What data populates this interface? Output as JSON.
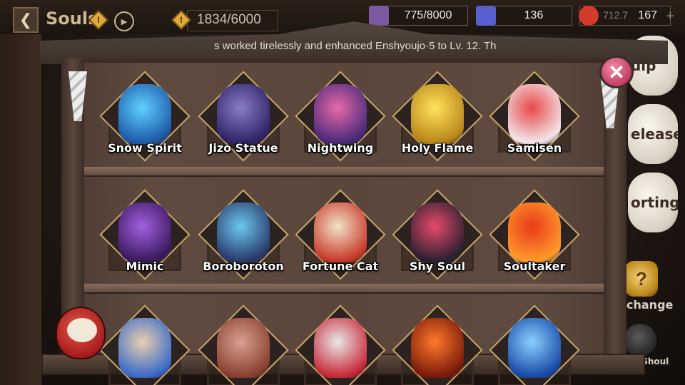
{
  "header": {
    "title": "Souls",
    "alert_glyph": "!",
    "capacity": "1834/6000"
  },
  "resources": [
    {
      "name": "stamina",
      "value": "775/8000",
      "color": "#7a5aa0"
    },
    {
      "name": "jade",
      "value": "136",
      "color": "#5a5fd0"
    },
    {
      "name": "event-currency",
      "value": "167",
      "color": "#d23a2a"
    }
  ],
  "overlay_value": "712.7",
  "ticker": "s worked tirelessly and enhanced Enshyoujo·5 to Lv. 12. Th",
  "side_buttons": {
    "quip": "uip",
    "release": "elease",
    "sorting": "orting",
    "change": "change",
    "ghoul": "Ghoul"
  },
  "souls": [
    {
      "name": "Snow Spirit",
      "colors": [
        "#5fd0ff",
        "#1d5aa8"
      ]
    },
    {
      "name": "Jizo Statue",
      "colors": [
        "#8b7cc8",
        "#2e2466"
      ]
    },
    {
      "name": "Nightwing",
      "colors": [
        "#e86aa8",
        "#4a2a7a"
      ]
    },
    {
      "name": "Holy Flame",
      "colors": [
        "#ffe35a",
        "#b8861a"
      ]
    },
    {
      "name": "Samisen",
      "colors": [
        "#e84848",
        "#f2e6ea"
      ]
    },
    {
      "name": "Mimic",
      "colors": [
        "#a35fe0",
        "#3a1a5e"
      ]
    },
    {
      "name": "Boroboroton",
      "colors": [
        "#6ac8f0",
        "#2a3a6a"
      ]
    },
    {
      "name": "Fortune Cat",
      "colors": [
        "#f2e2c8",
        "#c83a2a"
      ]
    },
    {
      "name": "Shy Soul",
      "colors": [
        "#e84a6a",
        "#2a2030"
      ]
    },
    {
      "name": "Soultaker",
      "colors": [
        "#e83a1a",
        "#ff9a2a"
      ]
    },
    {
      "name": "",
      "colors": [
        "#e8d0b0",
        "#3a6ac8"
      ]
    },
    {
      "name": "",
      "colors": [
        "#d8a090",
        "#8a4030"
      ]
    },
    {
      "name": "",
      "colors": [
        "#e8e8e8",
        "#c82a3a"
      ]
    },
    {
      "name": "",
      "colors": [
        "#ff7a2a",
        "#7a1a0a"
      ]
    },
    {
      "name": "",
      "colors": [
        "#8ad0ff",
        "#1a4aa8"
      ]
    }
  ],
  "close_glyph": "✕"
}
